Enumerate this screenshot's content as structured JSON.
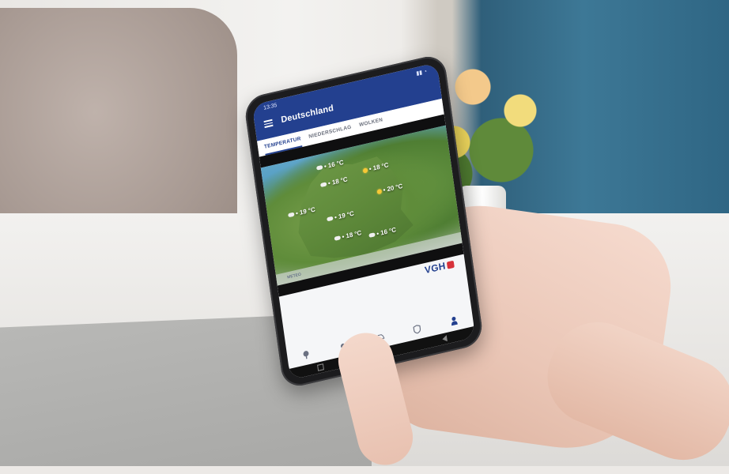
{
  "phone": {
    "status_time": "13:35",
    "app_title": "Deutschland",
    "tabs": [
      {
        "label": "TEMPERATUR",
        "active": true
      },
      {
        "label": "NIEDERSCHLAG",
        "active": false
      },
      {
        "label": "WOLKEN",
        "active": false
      }
    ],
    "map_temperatures": [
      {
        "value": "16 °C",
        "icon": "cloud-icon"
      },
      {
        "value": "18 °C",
        "icon": "cloud-icon"
      },
      {
        "value": "18 °C",
        "icon": "sun-icon"
      },
      {
        "value": "19 °C",
        "icon": "cloud-icon"
      },
      {
        "value": "20 °C",
        "icon": "sun-icon"
      },
      {
        "value": "19 °C",
        "icon": "cloud-icon"
      },
      {
        "value": "18 °C",
        "icon": "cloud-icon"
      },
      {
        "value": "16 °C",
        "icon": "cloud-icon"
      }
    ],
    "map_footer": "METEO",
    "brand": "VGH",
    "colors": {
      "appbar": "#23408f",
      "brand_red": "#d6323a",
      "map_green": "#5e8c3f",
      "map_water": "#5fa5c9"
    },
    "bottom_nav_icons": [
      "tree-icon",
      "dot-icon",
      "car-icon",
      "shield-icon",
      "person-icon"
    ]
  }
}
